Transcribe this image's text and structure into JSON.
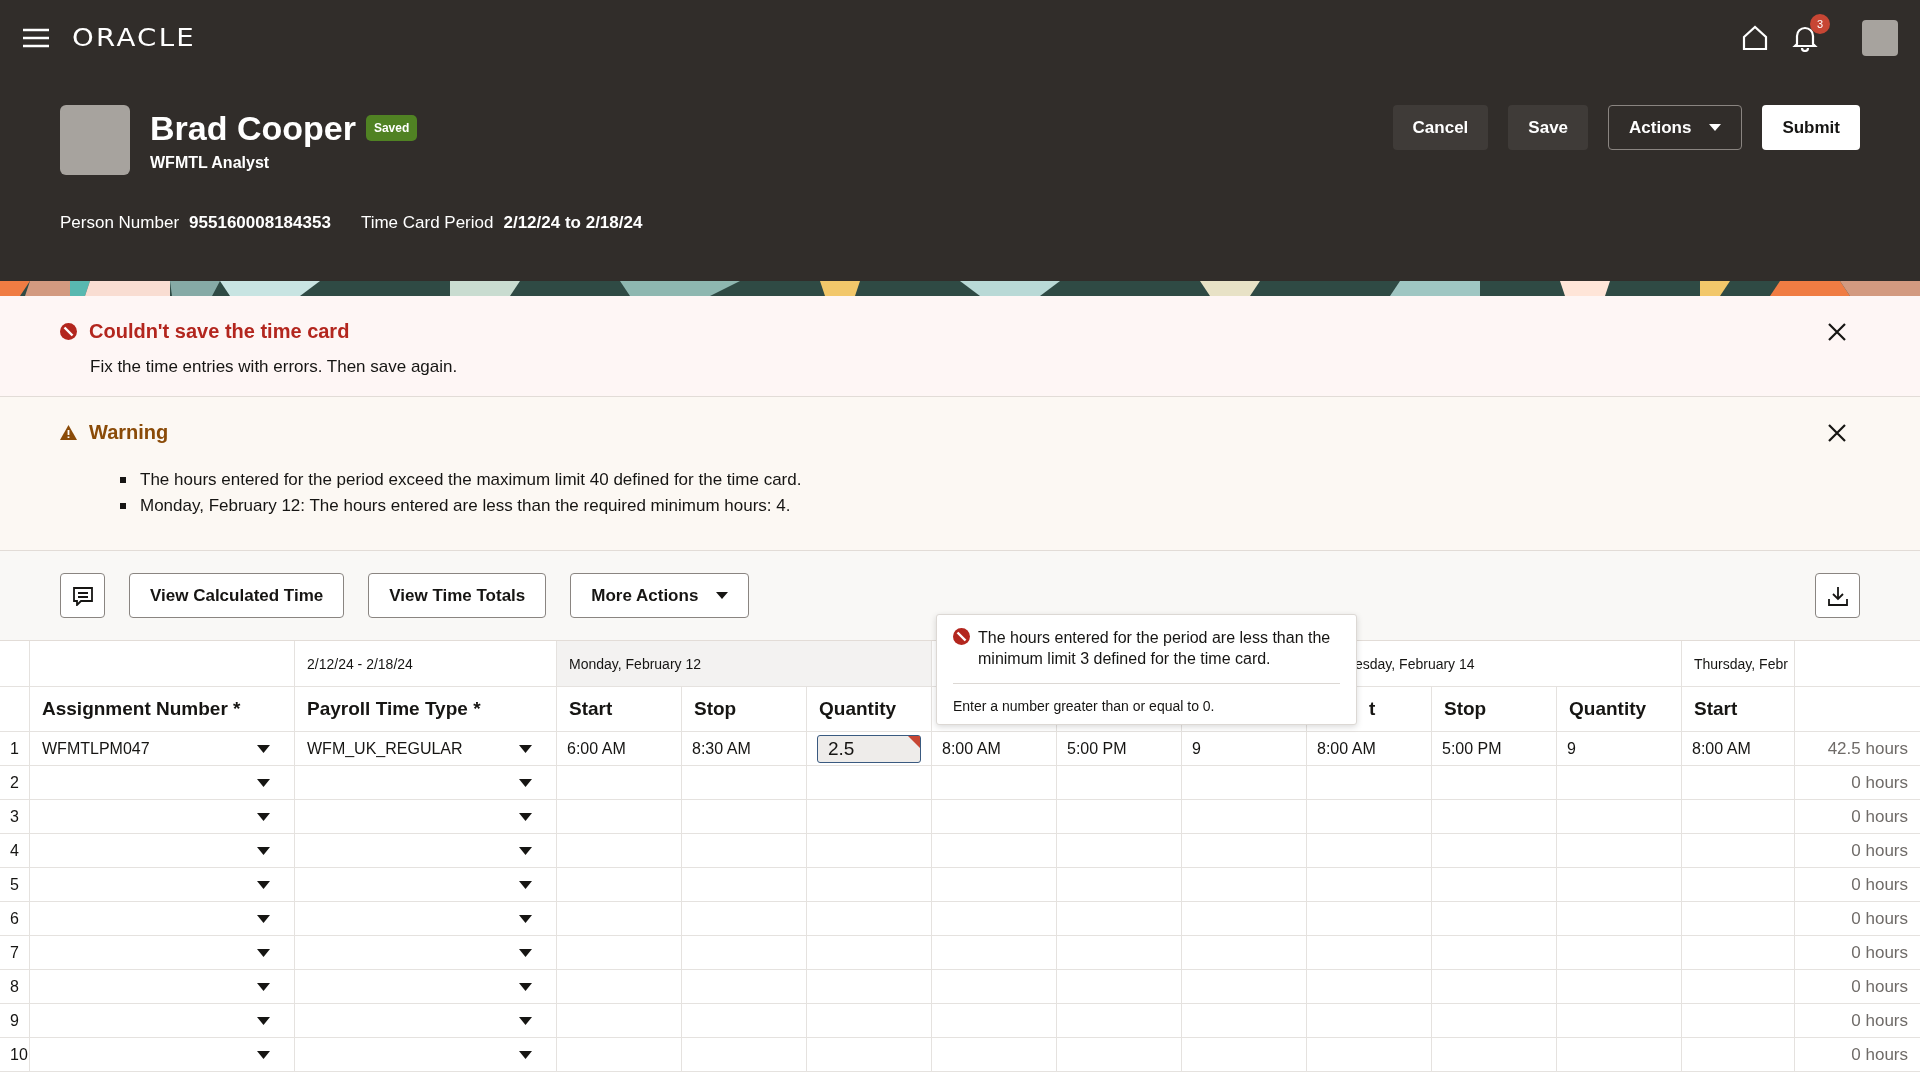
{
  "topbar": {
    "logo": "ORACLE",
    "notifications": "3"
  },
  "profile": {
    "name": "Brad Cooper",
    "status": "Saved",
    "role": "WFMTL Analyst",
    "fields": [
      {
        "label": "Person Number",
        "value": "955160008184353"
      },
      {
        "label": "Time Card Period",
        "value": "2/12/24 to 2/18/24"
      }
    ]
  },
  "actions": [
    {
      "label": "Cancel",
      "kind": "secondary"
    },
    {
      "label": "Save",
      "kind": "secondary"
    },
    {
      "label": "Actions",
      "kind": "menu"
    },
    {
      "label": "Submit",
      "kind": "primary"
    }
  ],
  "messages": [
    {
      "kind": "error",
      "title": "Couldn't save the time card",
      "text": "Fix the time entries with errors. Then save again."
    },
    {
      "kind": "warning",
      "title": "Warning",
      "items": [
        "The hours entered for the period exceed the maximum limit 40 defined for the time card.",
        "Monday, February 12: The hours entered are less than the required minimum hours: 4."
      ]
    }
  ],
  "toolbar": [
    {
      "label": "View Calculated Time",
      "kind": "plain"
    },
    {
      "label": "View Time Totals",
      "kind": "plain"
    },
    {
      "label": "More Actions",
      "kind": "menu"
    }
  ],
  "table": {
    "period": "2/12/24 - 2/18/24",
    "days": [
      {
        "label": "Monday, February 12",
        "highlighted": true
      },
      {
        "highlighted": false
      },
      {
        "label": "esday, February 14",
        "highlighted": false
      },
      {
        "label": "Thursday, Febr",
        "highlighted": false
      }
    ],
    "columns": [
      {
        "label": "Assignment Number *"
      },
      {
        "label": "Payroll Time Type *"
      },
      {
        "label": "Start"
      },
      {
        "label": "Stop"
      },
      {
        "label": "Quantity"
      },
      {},
      {},
      {},
      {
        "label": "t"
      },
      {
        "label": "Stop"
      },
      {
        "label": "Quantity"
      },
      {
        "label": "Start"
      }
    ],
    "rows": [
      {
        "number": "1",
        "assignment": "WFMTLPM047",
        "payroll": "WFM_UK_REGULAR",
        "total": "42.5 hours",
        "cells": [
          {
            "value": "6:00 AM",
            "error": false
          },
          {
            "value": "8:30 AM",
            "error": false
          },
          {
            "value": "2.5",
            "error": true
          },
          {
            "value": "8:00 AM",
            "error": false
          },
          {
            "value": "5:00 PM",
            "error": false
          },
          {
            "value": "9",
            "error": false
          },
          {
            "value": "8:00 AM",
            "error": false
          },
          {
            "value": "5:00 PM",
            "error": false
          },
          {
            "value": "9",
            "error": false
          },
          {
            "value": "8:00 AM",
            "error": false
          }
        ]
      },
      {
        "number": "2",
        "total": "0 hours"
      },
      {
        "number": "3",
        "total": "0 hours"
      },
      {
        "number": "4",
        "total": "0 hours"
      },
      {
        "number": "5",
        "total": "0 hours"
      },
      {
        "number": "6",
        "total": "0 hours"
      },
      {
        "number": "7",
        "total": "0 hours"
      },
      {
        "number": "8",
        "total": "0 hours"
      },
      {
        "number": "9",
        "total": "0 hours"
      },
      {
        "number": "10",
        "total": "0 hours"
      }
    ]
  },
  "tooltip": {
    "message": "The hours entered for the period are less than the minimum limit 3 defined for the time card.",
    "hint": "Enter a number greater than or equal to 0."
  }
}
